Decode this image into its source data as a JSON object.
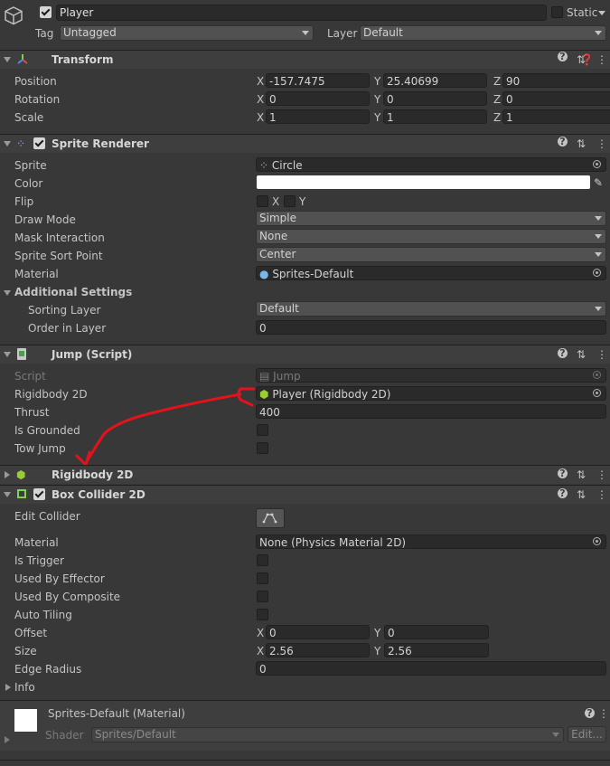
{
  "object": {
    "name": "Player",
    "static_label": "Static",
    "tag_label": "Tag",
    "tag_value": "Untagged",
    "layer_label": "Layer",
    "layer_value": "Default"
  },
  "transform": {
    "title": "Transform",
    "position_label": "Position",
    "rotation_label": "Rotation",
    "scale_label": "Scale",
    "axes": [
      "X",
      "Y",
      "Z"
    ],
    "position": [
      "-157.7475",
      "25.40699",
      "90"
    ],
    "rotation": [
      "0",
      "0",
      "0"
    ],
    "scale": [
      "1",
      "1",
      "1"
    ]
  },
  "sprite_renderer": {
    "title": "Sprite Renderer",
    "sprite_label": "Sprite",
    "sprite_value": "Circle",
    "color_label": "Color",
    "color_value": "#ffffff",
    "flip_label": "Flip",
    "flip_x": "X",
    "flip_y": "Y",
    "draw_mode_label": "Draw Mode",
    "draw_mode_value": "Simple",
    "mask_label": "Mask Interaction",
    "mask_value": "None",
    "sort_point_label": "Sprite Sort Point",
    "sort_point_value": "Center",
    "material_label": "Material",
    "material_value": "Sprites-Default",
    "additional_label": "Additional Settings",
    "sorting_layer_label": "Sorting Layer",
    "sorting_layer_value": "Default",
    "order_label": "Order in Layer",
    "order_value": "0"
  },
  "jump": {
    "title": "Jump (Script)",
    "script_label": "Script",
    "script_value": "Jump",
    "rigidbody_label": "Rigidbody 2D",
    "rigidbody_value": "Player (Rigidbody 2D)",
    "thrust_label": "Thrust",
    "thrust_value": "400",
    "grounded_label": "Is Grounded",
    "towjump_label": "Tow Jump"
  },
  "rigidbody": {
    "title": "Rigidbody 2D"
  },
  "box_collider": {
    "title": "Box Collider 2D",
    "edit_label": "Edit Collider",
    "material_label": "Material",
    "material_value": "None (Physics Material 2D)",
    "trigger_label": "Is Trigger",
    "effector_label": "Used By Effector",
    "composite_label": "Used By Composite",
    "tiling_label": "Auto Tiling",
    "offset_label": "Offset",
    "offset": [
      "0",
      "0"
    ],
    "size_label": "Size",
    "size": [
      "2.56",
      "2.56"
    ],
    "edge_label": "Edge Radius",
    "edge_value": "0",
    "info_label": "Info"
  },
  "material_section": {
    "title": "Sprites-Default (Material)",
    "shader_label": "Shader",
    "shader_value": "Sprites/Default",
    "edit_button": "Edit..."
  },
  "colors": {
    "annotation": "#e3121b",
    "rigidbody_icon": "#9acd32"
  }
}
